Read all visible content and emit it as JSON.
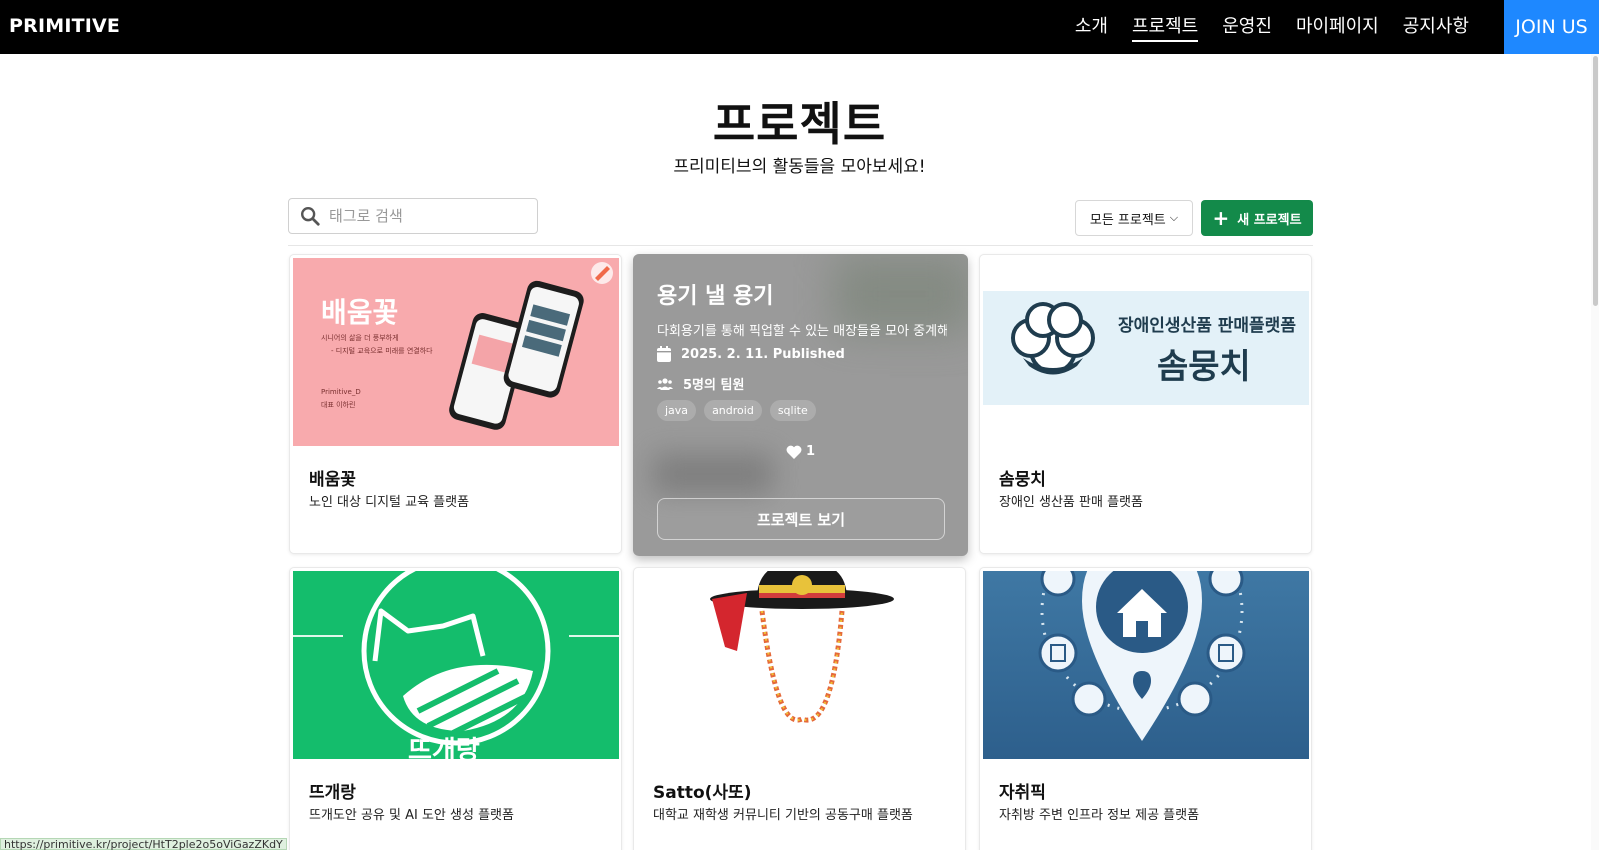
{
  "nav": {
    "brand": "PRIMITIVE",
    "links": [
      "소개",
      "프로젝트",
      "운영진",
      "마이페이지",
      "공지사항"
    ],
    "active": "프로젝트",
    "cta": "JOIN US"
  },
  "header": {
    "title": "프로젝트",
    "subtitle": "프리미티브의 활동들을 모아보세요!"
  },
  "toolbar": {
    "search_placeholder": "태그로 검색",
    "filter_label": "모든 프로젝트",
    "new_button": "새 프로젝트"
  },
  "cards": [
    {
      "title": "배움꽃",
      "desc": "노인 대상 디지털 교육 플랫폼"
    },
    {
      "title": "솜뭉치",
      "desc": "장애인 생산품 판매 플랫폼"
    },
    {
      "title": "뜨개랑",
      "desc": "뜨개도안 공유 및 AI 도안 생성 플랫폼"
    },
    {
      "title": "Satto(사또)",
      "desc": "대학교 재학생 커뮤니티 기반의 공동구매 플랫폼"
    },
    {
      "title": "자취픽",
      "desc": "자취방 주변 인프라 정보 제공 플랫폼"
    }
  ],
  "hover_card": {
    "title": "용기 낼 용기",
    "desc": "다회용기를 통해 픽업할 수 있는 매장들을 모아 중계해",
    "date": "2025. 2. 11. Published",
    "team": "5명의 팀원",
    "tags": [
      "java",
      "android",
      "sqlite"
    ],
    "likes": "1",
    "view_button": "프로젝트 보기"
  },
  "thumbs": {
    "baeum_logo": "배움꽃",
    "baeum_line1": "시니어의 삶을 더 풍부하게",
    "baeum_line2": "- 디지털 교육으로 미래를 연결하다",
    "baeum_credit1": "Primitive_D",
    "baeum_credit2": "대표 이하린",
    "som_subtitle": "장애인생산품 판매플랫폼",
    "som_title": "솜뭉치",
    "tteugae_text": "뜨개랑"
  },
  "statusbar": "https://primitive.kr/project/HtT2ple2o5oViGazZKdY",
  "colors": {
    "nav_bg": "#000000",
    "cta": "#1e88ff",
    "new_button": "#138a4a"
  }
}
